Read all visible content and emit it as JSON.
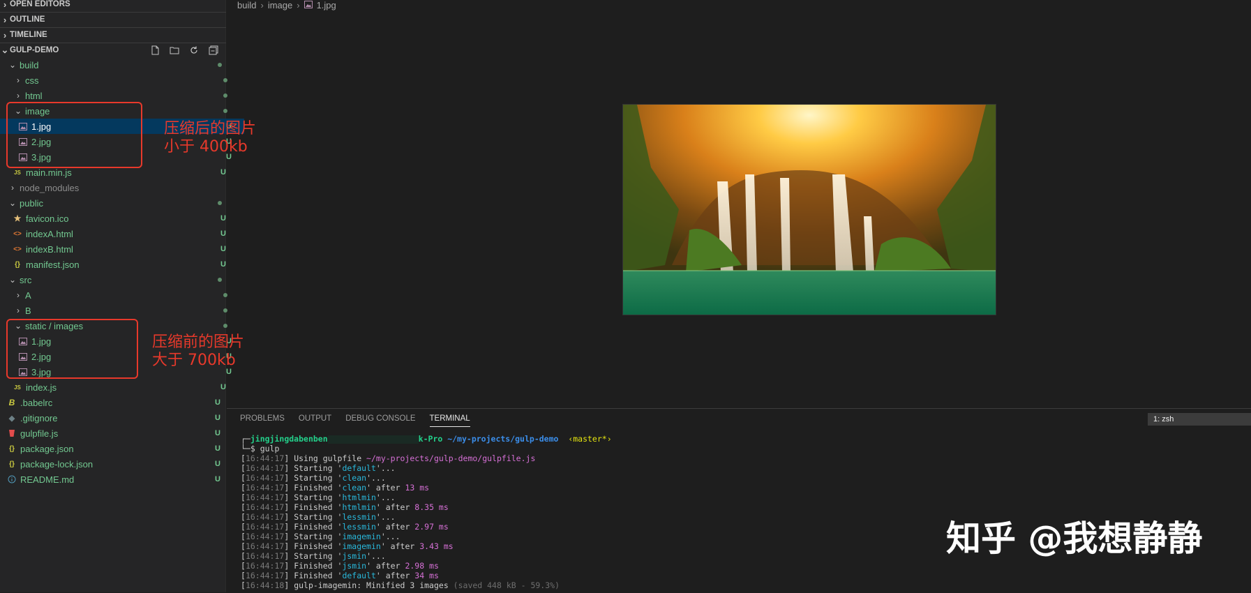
{
  "sidebar": {
    "sections": {
      "open_editors": "OPEN EDITORS",
      "outline": "OUTLINE",
      "timeline": "TIMELINE",
      "project": "GULP-DEMO"
    },
    "tree": [
      {
        "label": "build",
        "status": ""
      },
      {
        "label": "css",
        "status": ""
      },
      {
        "label": "html",
        "status": ""
      },
      {
        "label": "image",
        "status": ""
      },
      {
        "label": "1.jpg",
        "status": "U"
      },
      {
        "label": "2.jpg",
        "status": "U"
      },
      {
        "label": "3.jpg",
        "status": "U"
      },
      {
        "label": "main.min.js",
        "status": "U"
      },
      {
        "label": "node_modules",
        "status": ""
      },
      {
        "label": "public",
        "status": ""
      },
      {
        "label": "favicon.ico",
        "status": "U"
      },
      {
        "label": "indexA.html",
        "status": "U"
      },
      {
        "label": "indexB.html",
        "status": "U"
      },
      {
        "label": "manifest.json",
        "status": "U"
      },
      {
        "label": "src",
        "status": ""
      },
      {
        "label": "A",
        "status": ""
      },
      {
        "label": "B",
        "status": ""
      },
      {
        "label": "static / images",
        "status": ""
      },
      {
        "label": "1.jpg",
        "status": "U"
      },
      {
        "label": "2.jpg",
        "status": "U"
      },
      {
        "label": "3.jpg",
        "status": "U"
      },
      {
        "label": "index.js",
        "status": "U"
      },
      {
        "label": ".babelrc",
        "status": "U"
      },
      {
        "label": ".gitignore",
        "status": "U"
      },
      {
        "label": "gulpfile.js",
        "status": "U"
      },
      {
        "label": "package.json",
        "status": "U"
      },
      {
        "label": "package-lock.json",
        "status": "U"
      },
      {
        "label": "README.md",
        "status": "U"
      }
    ]
  },
  "annotations": {
    "after_line1": "压缩后的图片",
    "after_line2": "小于 400kb",
    "before_line1": "压缩前的图片",
    "before_line2": "大于 700kb"
  },
  "breadcrumb": [
    "build",
    "image",
    "1.jpg"
  ],
  "panel": {
    "tabs": [
      "PROBLEMS",
      "OUTPUT",
      "DEBUG CONSOLE",
      "TERMINAL"
    ],
    "active_tab": "TERMINAL",
    "terminal_select": "1: zsh"
  },
  "terminal": {
    "prompt_user": "jingjingdabenben",
    "prompt_host_tail": "k-Pro",
    "prompt_path": "~/my-projects/gulp-demo",
    "prompt_branch": "‹master*›",
    "command": "gulp",
    "lines": [
      {
        "ts": "16:44:17",
        "pre": "Using gulpfile ",
        "task": "",
        "path": "~/my-projects/gulp-demo/gulpfile.js",
        "post": "",
        "time": ""
      },
      {
        "ts": "16:44:17",
        "pre": "Starting '",
        "task": "default",
        "post": "'...",
        "time": ""
      },
      {
        "ts": "16:44:17",
        "pre": "Starting '",
        "task": "clean",
        "post": "'...",
        "time": ""
      },
      {
        "ts": "16:44:17",
        "pre": "Finished '",
        "task": "clean",
        "post": "' after ",
        "time": "13 ms"
      },
      {
        "ts": "16:44:17",
        "pre": "Starting '",
        "task": "htmlmin",
        "post": "'...",
        "time": ""
      },
      {
        "ts": "16:44:17",
        "pre": "Finished '",
        "task": "htmlmin",
        "post": "' after ",
        "time": "8.35 ms"
      },
      {
        "ts": "16:44:17",
        "pre": "Starting '",
        "task": "lessmin",
        "post": "'...",
        "time": ""
      },
      {
        "ts": "16:44:17",
        "pre": "Finished '",
        "task": "lessmin",
        "post": "' after ",
        "time": "2.97 ms"
      },
      {
        "ts": "16:44:17",
        "pre": "Starting '",
        "task": "imagemin",
        "post": "'...",
        "time": ""
      },
      {
        "ts": "16:44:17",
        "pre": "Finished '",
        "task": "imagemin",
        "post": "' after ",
        "time": "3.43 ms"
      },
      {
        "ts": "16:44:17",
        "pre": "Starting '",
        "task": "jsmin",
        "post": "'...",
        "time": ""
      },
      {
        "ts": "16:44:17",
        "pre": "Finished '",
        "task": "jsmin",
        "post": "' after ",
        "time": "2.98 ms"
      },
      {
        "ts": "16:44:17",
        "pre": "Finished '",
        "task": "default",
        "post": "' after ",
        "time": "34 ms"
      },
      {
        "ts": "16:44:18",
        "pre": "gulp-imagemin: Minified 3 images ",
        "task": "",
        "post": "",
        "time": "",
        "dim": "(saved 448 kB - 59.3%)"
      }
    ]
  },
  "watermark": "知乎 @我想静静",
  "colors": {
    "accent_red": "#e8392b",
    "selection": "#04395e",
    "untracked_green": "#73c991"
  }
}
